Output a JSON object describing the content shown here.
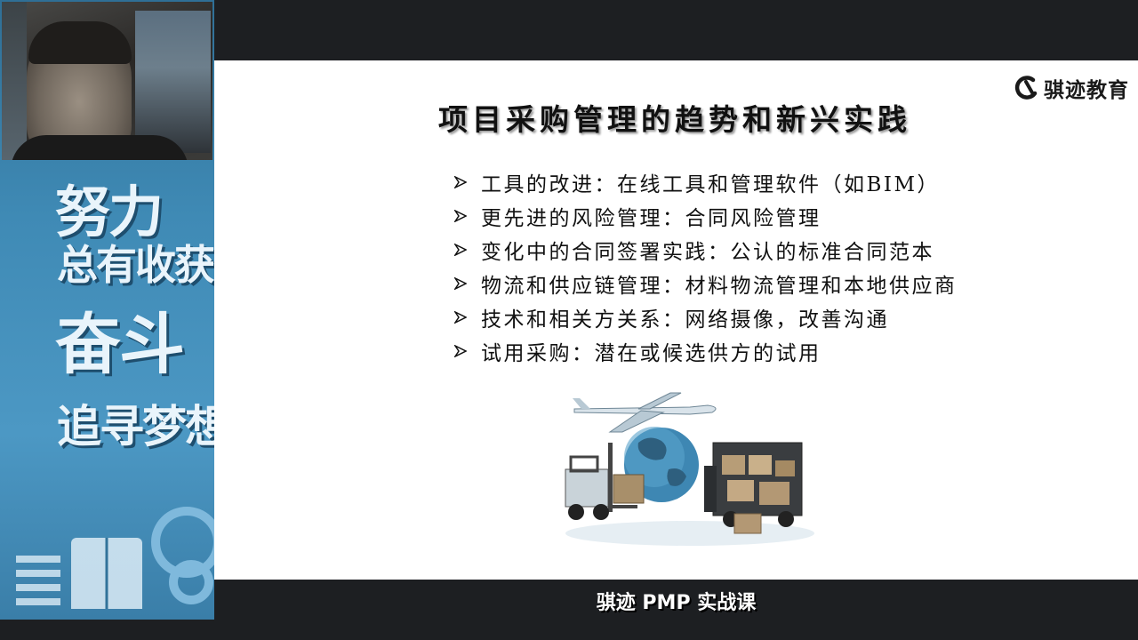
{
  "sidebar": {
    "poster": {
      "line1": "努力",
      "line2": "总有收获",
      "line3": "奋斗",
      "line4": "追寻梦想"
    }
  },
  "slide": {
    "logo_text": "骐迹教育",
    "title": "项目采购管理的趋势和新兴实践",
    "bullets": [
      "工具的改进：在线工具和管理软件（如BIM）",
      "更先进的风险管理：合同风险管理",
      "变化中的合同签署实践：公认的标准合同范本",
      "物流和供应链管理：材料物流管理和本地供应商",
      "技术和相关方关系：网络摄像，改善沟通",
      "试用采购：潜在或候选供方的试用"
    ]
  },
  "caption": "骐迹 PMP 实战课",
  "colors": {
    "sidebar_blue": "#3f8ab5",
    "slide_bg": "#ffffff",
    "page_bg": "#1d1f22"
  }
}
